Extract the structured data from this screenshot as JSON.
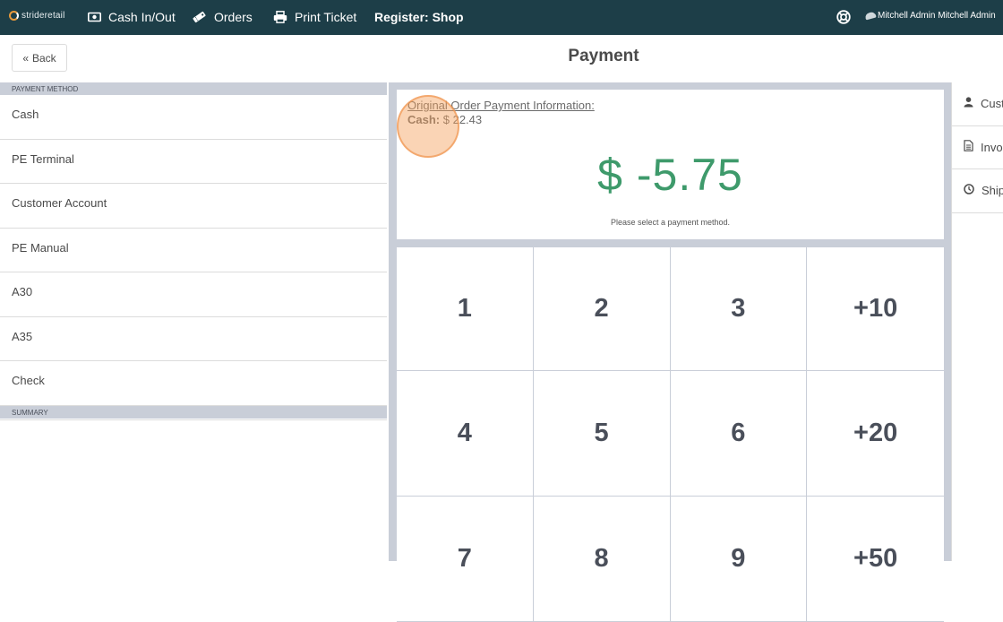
{
  "navbar": {
    "logo_text": "strideretail",
    "items": [
      {
        "label": "Cash In/Out",
        "icon": "cash-icon"
      },
      {
        "label": "Orders",
        "icon": "tag-icon"
      },
      {
        "label": "Print Ticket",
        "icon": "printer-icon"
      }
    ],
    "register": "Register: Shop",
    "user": "Mitchell Admin Mitchell Admin"
  },
  "header": {
    "back_label": "Back",
    "title": "Payment"
  },
  "left_panel": {
    "payment_method_header": "PAYMENT METHOD",
    "methods": [
      "Cash",
      "PE Terminal",
      "Customer Account",
      "PE Manual",
      "A30",
      "A35",
      "Check"
    ],
    "summary_header": "SUMMARY"
  },
  "info": {
    "orig_title": "Original Order Payment Information:",
    "cash_label": "Cash:",
    "cash_value": "$ 22.43",
    "amount": "$ -5.75",
    "note": "Please select a payment method."
  },
  "keypad": {
    "keys": [
      "1",
      "2",
      "3",
      "+10",
      "4",
      "5",
      "6",
      "+20",
      "7",
      "8",
      "9",
      "+50"
    ]
  },
  "right_panel": {
    "items": [
      {
        "label": "Customer",
        "icon": "user-icon"
      },
      {
        "label": "Invoice",
        "icon": "document-icon"
      },
      {
        "label": "Ship Later",
        "icon": "clock-icon"
      }
    ]
  },
  "colors": {
    "navbar": "#1d3e48",
    "amount": "#3e9a6b",
    "panel_bg": "#c9ced8",
    "click_highlight": "#f5a05a"
  }
}
